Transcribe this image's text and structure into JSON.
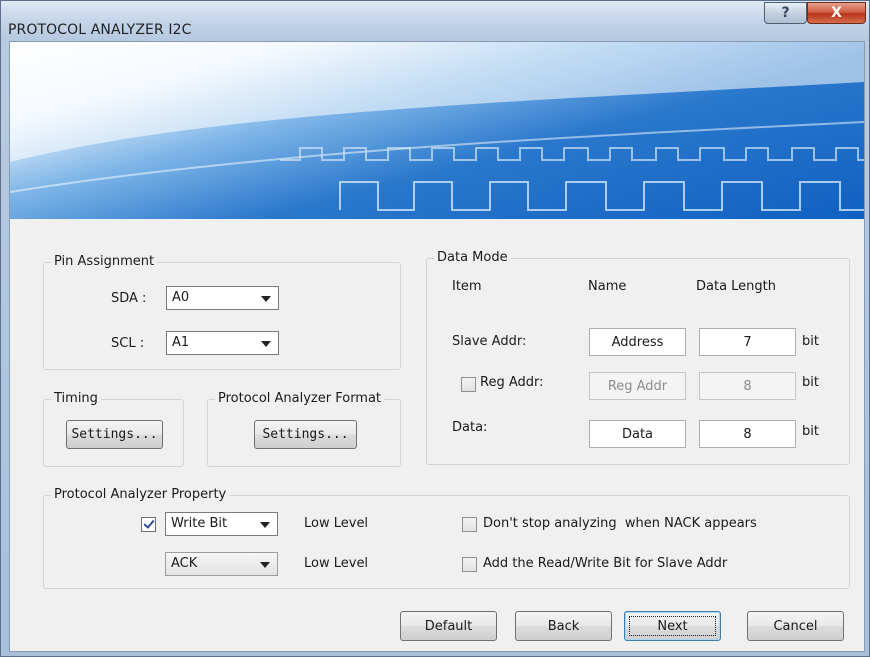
{
  "window": {
    "title": "PROTOCOL ANALYZER I2C",
    "help_label": "?",
    "close_label": "X"
  },
  "pin_assignment": {
    "legend": "Pin Assignment",
    "sda_label": "SDA :",
    "sda_value": "A0",
    "scl_label": "SCL :",
    "scl_value": "A1"
  },
  "timing": {
    "legend": "Timing",
    "settings_label": "Settings..."
  },
  "format": {
    "legend": "Protocol Analyzer Format",
    "settings_label": "Settings..."
  },
  "data_mode": {
    "legend": "Data Mode",
    "headers": {
      "item": "Item",
      "name": "Name",
      "length": "Data Length"
    },
    "rows": [
      {
        "item": "Slave Addr:",
        "name": "Address",
        "length": "7",
        "unit": "bit",
        "enabled": true
      },
      {
        "item": "Reg Addr:",
        "name": "Reg Addr",
        "length": "8",
        "unit": "bit",
        "enabled": false,
        "checked": false
      },
      {
        "item": "Data:",
        "name": "Data",
        "length": "8",
        "unit": "bit",
        "enabled": true
      }
    ]
  },
  "property": {
    "legend": "Protocol Analyzer Property",
    "write_bit_checked": true,
    "write_bit_value": "Write Bit",
    "write_bit_level": "Low Level",
    "ack_value": "ACK",
    "ack_level": "Low Level",
    "nack_option": {
      "label": "Don't stop analyzing  when NACK appears",
      "checked": false
    },
    "rw_option": {
      "label": "Add the Read/Write Bit for Slave Addr",
      "checked": false
    }
  },
  "footer": {
    "default_label": "Default",
    "back_label": "Back",
    "next_label": "Next",
    "cancel_label": "Cancel"
  }
}
